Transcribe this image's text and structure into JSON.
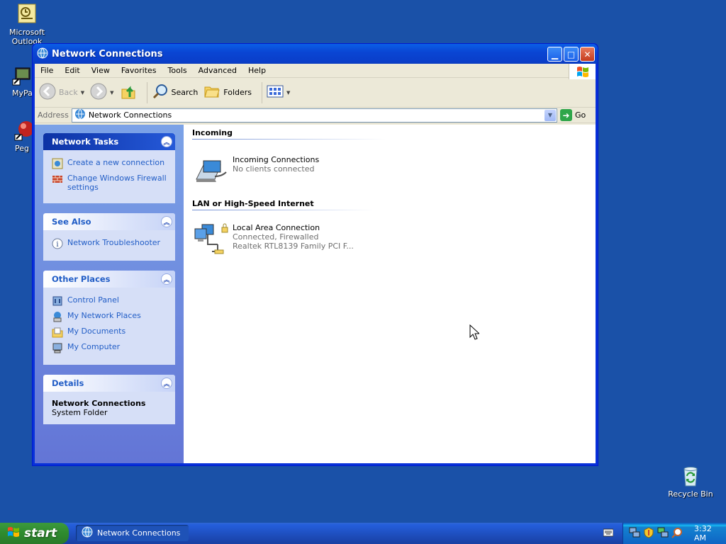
{
  "desktop": {
    "icons": [
      {
        "label": "Microsoft Outlook",
        "icon": "outlook-icon"
      },
      {
        "label": "MyPa",
        "icon": "mypc-icon"
      },
      {
        "label": "Peg",
        "icon": "peg-icon"
      },
      {
        "label": "Recycle Bin",
        "icon": "recycle-bin-icon"
      }
    ]
  },
  "window": {
    "title": "Network Connections",
    "menu": [
      "File",
      "Edit",
      "View",
      "Favorites",
      "Tools",
      "Advanced",
      "Help"
    ],
    "toolbar": {
      "back": "Back",
      "search": "Search",
      "folders": "Folders"
    },
    "address": {
      "label": "Address",
      "value": "Network Connections",
      "go": "Go"
    },
    "tasks": {
      "network_tasks": {
        "title": "Network Tasks",
        "items": [
          "Create a new connection",
          "Change Windows Firewall settings"
        ]
      },
      "see_also": {
        "title": "See Also",
        "items": [
          "Network Troubleshooter"
        ]
      },
      "other_places": {
        "title": "Other Places",
        "items": [
          "Control Panel",
          "My Network Places",
          "My Documents",
          "My Computer"
        ]
      },
      "details": {
        "title": "Details",
        "name": "Network Connections",
        "type": "System Folder"
      }
    },
    "groups": [
      {
        "title": "Incoming",
        "items": [
          {
            "name": "Incoming Connections",
            "line1": "No clients connected",
            "line2": ""
          }
        ]
      },
      {
        "title": "LAN or High-Speed Internet",
        "items": [
          {
            "name": "Local Area Connection",
            "line1": "Connected, Firewalled",
            "line2": "Realtek RTL8139 Family PCI F..."
          }
        ]
      }
    ]
  },
  "taskbar": {
    "start": "start",
    "open_window": "Network Connections",
    "clock": "3:32 AM"
  },
  "colors": {
    "desktop": "#1a51a8",
    "title_bar": "#0a46d4",
    "task_link": "#215dc6",
    "start_button": "#2e8b2e"
  }
}
